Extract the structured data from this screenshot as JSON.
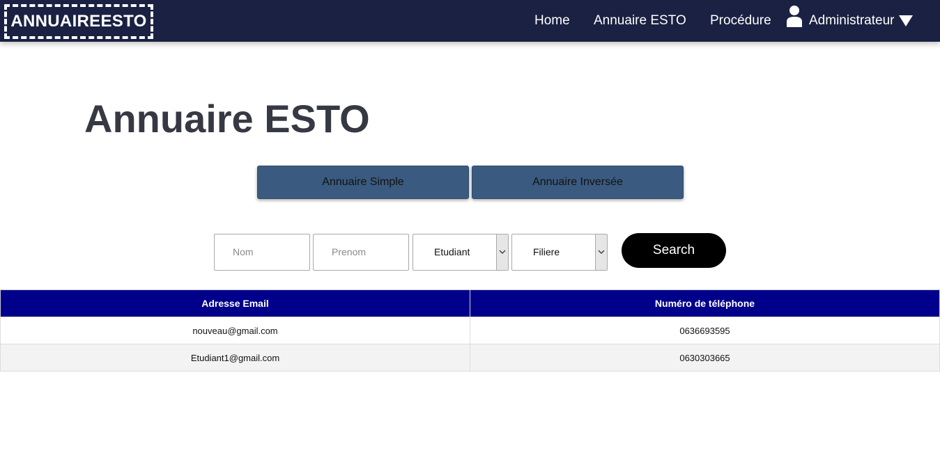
{
  "header": {
    "logo": "ANNUAIREESTO",
    "nav": [
      {
        "label": "Home"
      },
      {
        "label": "Annuaire ESTO"
      },
      {
        "label": "Procédure"
      }
    ],
    "user": {
      "label": "Administrateur",
      "icon": "user-icon",
      "caret": "caret-down-icon"
    }
  },
  "main": {
    "title": "Annuaire ESTO",
    "tabs": [
      {
        "label": "Annuaire Simple"
      },
      {
        "label": "Annuaire Inversée"
      }
    ],
    "search": {
      "nom_placeholder": "Nom",
      "prenom_placeholder": "Prenom",
      "type_selected": "Etudiant",
      "filiere_selected": "Filiere",
      "button_label": "Search"
    },
    "table": {
      "headers": [
        "Adresse Email",
        "Numéro de téléphone"
      ],
      "rows": [
        [
          "nouveau@gmail.com",
          "0636693595"
        ],
        [
          "Etudiant1@gmail.com",
          "0630303665"
        ]
      ]
    }
  },
  "colors": {
    "topbar": "#1a2142",
    "tab_button": "#3b5a80",
    "table_header": "#00008b",
    "search_button": "#000000",
    "title_text": "#363843"
  }
}
